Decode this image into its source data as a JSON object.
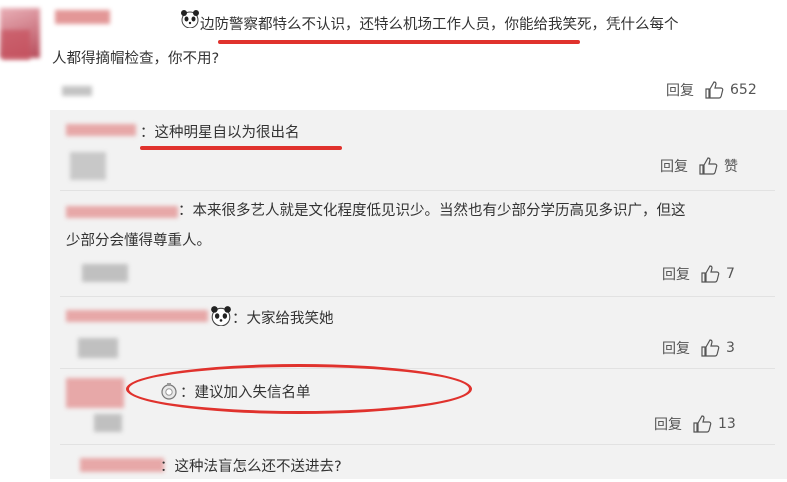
{
  "colors": {
    "accent_red": "#e0322d",
    "panel_bg": "#f2f2f2"
  },
  "comments": [
    {
      "text_line1": "边防警察都特么不认识，还特么机场工作人员，你能给我笑死，凭什么每个",
      "text_line2": "人都得摘帽检查，你不用?",
      "reply_label": "回复",
      "like_count": "652"
    },
    {
      "text": "：这种明星自以为很出名",
      "reply_label": "回复",
      "like_count": "赞"
    },
    {
      "text_line1": "：本来很多艺人就是文化程度低见识少。当然也有少部分学历高见多识广，但这",
      "text_line2": "少部分会懂得尊重人。",
      "reply_label": "回复",
      "like_count": "7"
    },
    {
      "text": "：大家给我笑她",
      "reply_label": "回复",
      "like_count": "3"
    },
    {
      "text": "：建议加入失信名单",
      "reply_label": "回复",
      "like_count": "13"
    },
    {
      "text": "：这种法盲怎么还不送进去?"
    }
  ],
  "icons": [
    "panda-emoji-icon",
    "thumbs-up-icon",
    "avatar-badge-icon"
  ]
}
